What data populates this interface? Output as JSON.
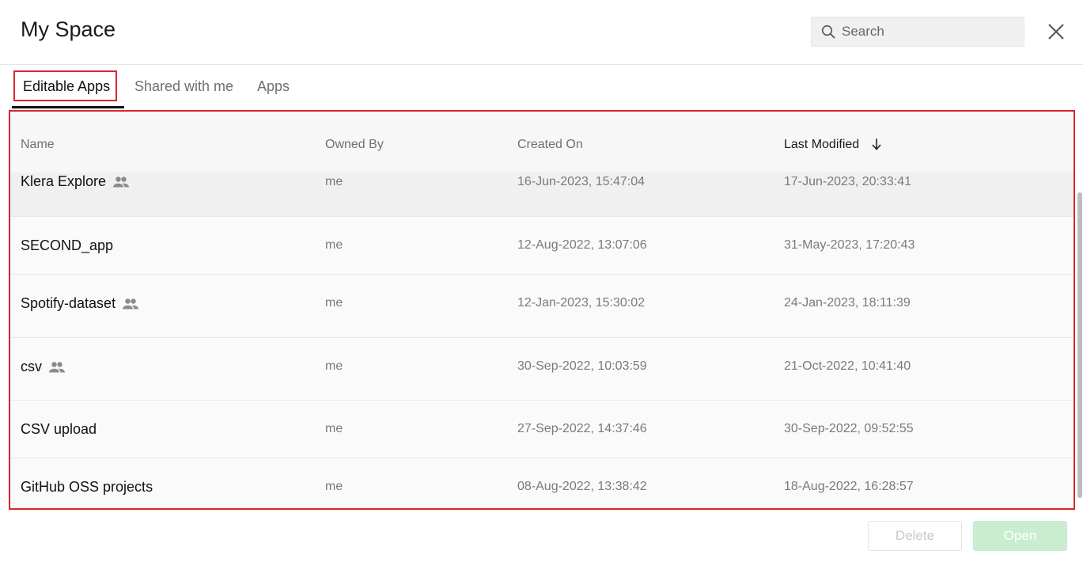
{
  "header": {
    "title": "My Space",
    "search_placeholder": "Search"
  },
  "tabs": [
    {
      "label": "Editable Apps",
      "active": true
    },
    {
      "label": "Shared with me",
      "active": false
    },
    {
      "label": "Apps",
      "active": false
    }
  ],
  "table": {
    "columns": [
      "Name",
      "Owned By",
      "Created On",
      "Last Modified"
    ],
    "sort_column": "Last Modified",
    "sort_direction": "descending",
    "rows": [
      {
        "name": "Klera Explore",
        "shared": true,
        "owner": "me",
        "created": "16-Jun-2023, 15:47:04",
        "modified": "17-Jun-2023, 20:33:41"
      },
      {
        "name": "SECOND_app",
        "shared": false,
        "owner": "me",
        "created": "12-Aug-2022, 13:07:06",
        "modified": "31-May-2023, 17:20:43"
      },
      {
        "name": "Spotify-dataset",
        "shared": true,
        "owner": "me",
        "created": "12-Jan-2023, 15:30:02",
        "modified": "24-Jan-2023, 18:11:39"
      },
      {
        "name": "csv",
        "shared": true,
        "owner": "me",
        "created": "30-Sep-2022, 10:03:59",
        "modified": "21-Oct-2022, 10:41:40"
      },
      {
        "name": "CSV upload",
        "shared": false,
        "owner": "me",
        "created": "27-Sep-2022, 14:37:46",
        "modified": "30-Sep-2022, 09:52:55"
      },
      {
        "name": "GitHub OSS projects",
        "shared": false,
        "owner": "me",
        "created": "08-Aug-2022, 13:38:42",
        "modified": "18-Aug-2022, 16:28:57"
      }
    ]
  },
  "footer": {
    "delete_label": "Delete",
    "open_label": "Open"
  },
  "colors": {
    "highlight_border": "#d9262e",
    "open_button_disabled": "#c9edce"
  }
}
